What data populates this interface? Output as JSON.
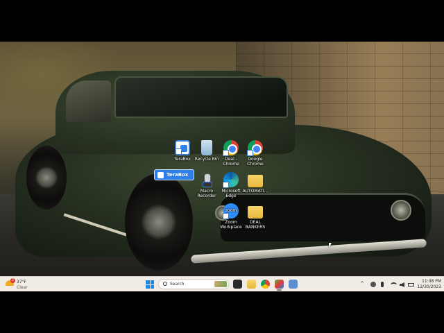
{
  "desktop": {
    "icons": [
      {
        "label": "TeraBox",
        "icon": "terabox-icon"
      },
      {
        "label": "Recycle Bin",
        "icon": "recycle-bin-icon"
      },
      {
        "label": "Deal - Chrome",
        "icon": "chrome-icon"
      },
      {
        "label": "Google Chrome",
        "icon": "chrome-icon"
      },
      {
        "label": "Macro Recorder",
        "icon": "macro-recorder-icon"
      },
      {
        "label": "Microsoft Edge",
        "icon": "edge-icon"
      },
      {
        "label": "AUTOMATI...",
        "icon": "folder-icon"
      },
      {
        "label": "Zoom Workplace",
        "icon": "zoom-icon"
      },
      {
        "label": "DEAL BANKERS",
        "icon": "folder-icon"
      }
    ],
    "terabox_tip": "TeraBox",
    "zoom_glyph": "zoom"
  },
  "taskbar": {
    "weather": {
      "temp": "37°F",
      "condition": "Clear",
      "badge": "2"
    },
    "search_label": "Search",
    "tray": {
      "chevron": "^"
    },
    "clock": {
      "time": "11:08 PM",
      "date": "12/30/2023"
    }
  },
  "colors": {
    "accent": "#2f7fe8",
    "taskbar": "#f1ede6"
  }
}
